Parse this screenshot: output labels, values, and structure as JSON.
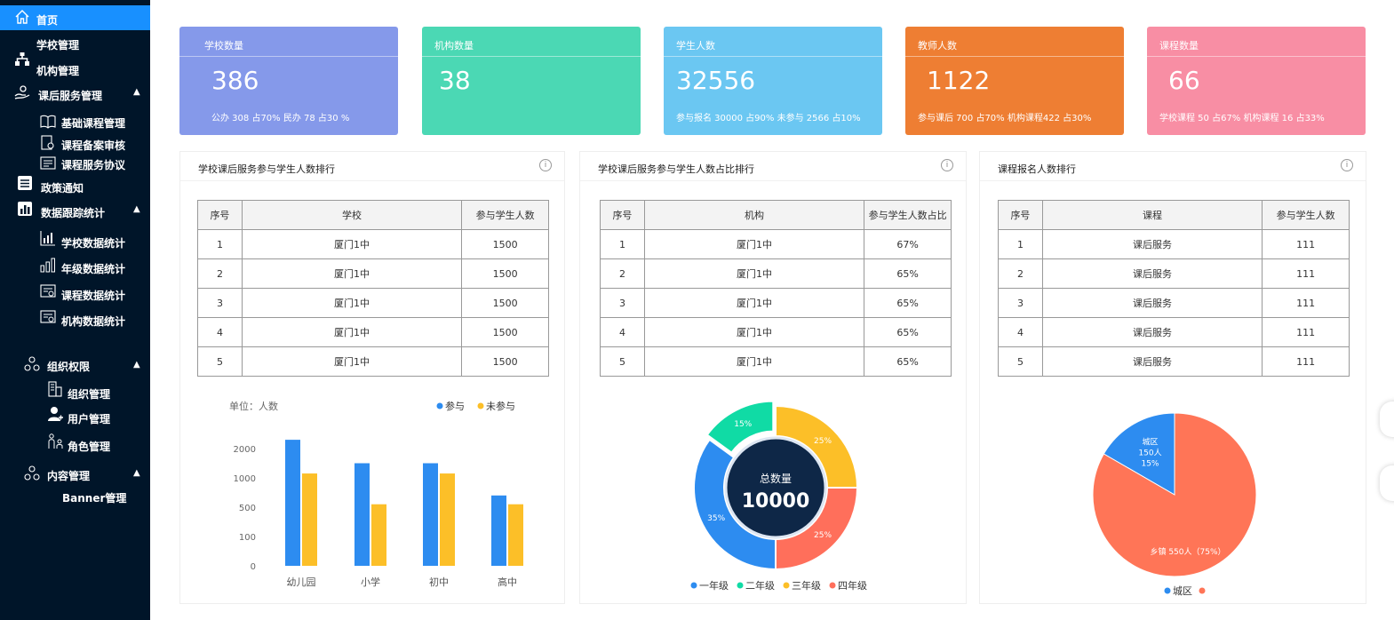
{
  "sidebar": {
    "home": "首页",
    "school_mgmt": "学校管理",
    "org_mgmt": "机构管理",
    "after_school_mgmt": "课后服务管理",
    "basic_course_mgmt": "基础课程管理",
    "course_record_review": "课程备案审核",
    "course_service_agreement": "课程服务协议",
    "policy_notice": "政策通知",
    "data_tracking": "数据跟踪统计",
    "school_data_stats": "学校数据统计",
    "grade_data_stats": "年级数据统计",
    "course_data_stats": "课程数据统计",
    "org_data_stats": "机构数据统计",
    "org_permissions": "组织权限",
    "org_admin": "组织管理",
    "user_mgmt": "用户管理",
    "role_mgmt": "角色管理",
    "content_mgmt": "内容管理",
    "banner_mgmt": "Banner管理"
  },
  "stats": [
    {
      "title": "学校数量",
      "value": "386",
      "sub": "公办 308 占70%      民办 78 占30 %",
      "color": "#8599ea"
    },
    {
      "title": "机构数量",
      "value": "38",
      "sub": "",
      "color": "#4bd8b4"
    },
    {
      "title": "学生人数",
      "value": "32556",
      "sub": "参与报名 30000  占90%    未参与 2566  占10%",
      "color": "#6bc7f2"
    },
    {
      "title": "教师人数",
      "value": "1122",
      "sub": "参与课后 700 占70%    机构课程422 占30%",
      "color": "#ee7e33"
    },
    {
      "title": "课程数量",
      "value": "66",
      "sub": "学校课程 50 占67%      机构课程 16 占33%",
      "color": "#f88ea4"
    }
  ],
  "panels": {
    "school_rank": {
      "title": "学校课后服务参与学生人数排行",
      "headers": [
        "序号",
        "学校",
        "参与学生人数"
      ],
      "rows": [
        [
          "1",
          "厦门1中",
          "1500"
        ],
        [
          "2",
          "厦门1中",
          "1500"
        ],
        [
          "3",
          "厦门1中",
          "1500"
        ],
        [
          "4",
          "厦门1中",
          "1500"
        ],
        [
          "5",
          "厦门1中",
          "1500"
        ]
      ]
    },
    "org_ratio": {
      "title": "学校课后服务参与学生人数占比排行",
      "headers": [
        "序号",
        "机构",
        "参与学生人数占比"
      ],
      "rows": [
        [
          "1",
          "厦门1中",
          "67%"
        ],
        [
          "2",
          "厦门1中",
          "65%"
        ],
        [
          "3",
          "厦门1中",
          "65%"
        ],
        [
          "4",
          "厦门1中",
          "65%"
        ],
        [
          "5",
          "厦门1中",
          "65%"
        ]
      ]
    },
    "course_rank": {
      "title": "课程报名人数排行",
      "headers": [
        "序号",
        "课程",
        "参与学生人数"
      ],
      "rows": [
        [
          "1",
          "课后服务",
          "111"
        ],
        [
          "2",
          "课后服务",
          "111"
        ],
        [
          "3",
          "课后服务",
          "111"
        ],
        [
          "4",
          "课后服务",
          "111"
        ],
        [
          "5",
          "课后服务",
          "111"
        ]
      ]
    }
  },
  "info_icon": "info-circle-icon",
  "chart_data": [
    {
      "type": "bar",
      "unit_label": "单位：人数",
      "categories": [
        "幼儿园",
        "小学",
        "初中",
        "高中"
      ],
      "y_ticks": [
        "0",
        "100",
        "500",
        "1000",
        "2000"
      ],
      "series": [
        {
          "name": "参与",
          "color": "#2d8cf0",
          "values": [
            2300,
            1500,
            1500,
            700
          ]
        },
        {
          "name": "未参与",
          "color": "#fcbf28",
          "values": [
            1150,
            550,
            1150,
            550
          ]
        }
      ]
    },
    {
      "type": "pie",
      "center_label": "总数量",
      "center_value": "10000",
      "slices": [
        {
          "name": "一年级",
          "value": 35,
          "label": "35%",
          "color": "#2d8cf0"
        },
        {
          "name": "二年级",
          "value": 15,
          "label": "15%",
          "color": "#10dba5"
        },
        {
          "name": "三年级",
          "value": 25,
          "label": "25%",
          "color": "#fcbf28"
        },
        {
          "name": "四年级",
          "value": 25,
          "label": "25%",
          "color": "#ff6f5b"
        }
      ]
    },
    {
      "type": "pie",
      "slices": [
        {
          "name": "城区",
          "value": 15,
          "label_lines": [
            "城区",
            "150人",
            "15%"
          ],
          "color": "#2d8cf0"
        },
        {
          "name": "乡镇",
          "value": 75,
          "label_lines": [
            "乡镇 550人（75%）"
          ],
          "color": "#ff7557"
        }
      ],
      "legend": [
        "城区"
      ]
    }
  ]
}
